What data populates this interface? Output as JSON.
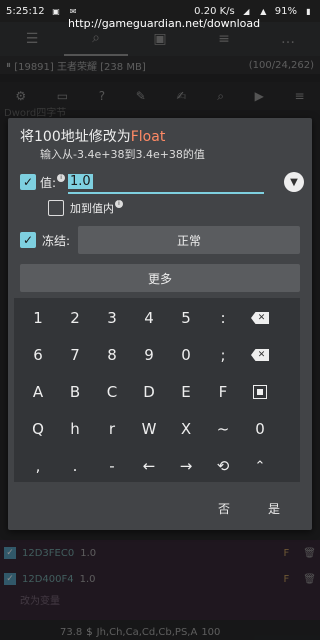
{
  "status_bar": {
    "time": "5:25:12",
    "speed": "0.20 K/s",
    "battery": "91%",
    "url": "http://gameguardian.net/download"
  },
  "background": {
    "process": "[19891] 王者荣耀 [238 MB]",
    "count": "(100/24,262)",
    "top_text": "Dword四字节",
    "list_rows": [
      {
        "address": "12D3FEC0",
        "value": "1.0",
        "flag": "F"
      },
      {
        "address": "12D400F4",
        "value": "1.0",
        "flag": "F"
      }
    ],
    "list_note": "改为变量",
    "bottom_value": "73.8",
    "bottom_types": "Jh,Ch,Ca,Cd,Cb,PS,A",
    "bottom_count": "100"
  },
  "dialog": {
    "title_prefix": "将100地址修改为",
    "title_type": "Float",
    "subtitle": "输入从-3.4e+38到3.4e+38的值",
    "value_label": "值:",
    "value": "1.0",
    "increment_label": "加到值内",
    "freeze_label": "冻结:",
    "freeze_mode": "正常",
    "more_label": "更多",
    "cancel_label": "否",
    "ok_label": "是"
  },
  "keypad": {
    "rows": [
      [
        "1",
        "2",
        "3",
        "4",
        "5",
        ":",
        "backspace-icon"
      ],
      [
        "6",
        "7",
        "8",
        "9",
        "0",
        ";",
        "clear-icon"
      ],
      [
        "A",
        "B",
        "C",
        "D",
        "E",
        "F",
        "select-all-icon"
      ],
      [
        "Q",
        "h",
        "r",
        "W",
        "X",
        "~",
        "0"
      ],
      [
        ",",
        ".",
        "-",
        "←",
        "→",
        "history-icon",
        "collapse-icon"
      ]
    ]
  },
  "colors": {
    "accent": "#7ed0e0",
    "type_highlight": "#ff8a65",
    "dialog_bg": "#424447",
    "keypad_bg": "#333538"
  }
}
